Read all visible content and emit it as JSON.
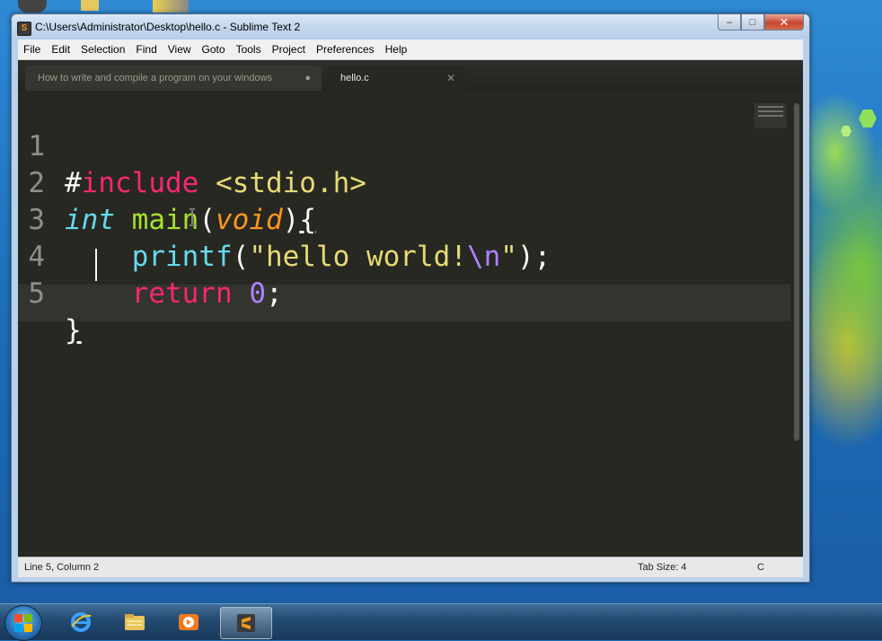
{
  "window": {
    "title": "C:\\Users\\Administrator\\Desktop\\hello.c - Sublime Text 2",
    "minimize": "–",
    "maximize": "□",
    "close": "✕"
  },
  "menu": [
    "File",
    "Edit",
    "Selection",
    "Find",
    "View",
    "Goto",
    "Tools",
    "Project",
    "Preferences",
    "Help"
  ],
  "tabs": [
    {
      "label": "How to write and compile a program on your windows",
      "marker": "●"
    },
    {
      "label": "hello.c",
      "marker": "✕"
    }
  ],
  "code": {
    "line_numbers": [
      "1",
      "2",
      "3",
      "4",
      "5"
    ],
    "line1": {
      "hash": "#",
      "include": "include",
      "header": " <stdio.h>"
    },
    "line2": {
      "int": "int",
      "main": " main",
      "paren_open": "(",
      "void": "void",
      "paren_close": ")",
      "brace": "{"
    },
    "line3": {
      "indent": "    ",
      "printf": "printf",
      "paren_open": "(",
      "string": "\"hello world!",
      "escape": "\\n",
      "quote": "\"",
      "end": ");"
    },
    "line4": {
      "indent": "    ",
      "return": "return",
      "space": " ",
      "zero": "0",
      "semi": ";"
    },
    "line5": {
      "brace": "}"
    }
  },
  "status": {
    "position": "Line 5, Column 2",
    "tab_size": "Tab Size: 4",
    "syntax": "C"
  },
  "colors": {
    "editor_bg": "#272822",
    "keyword": "#f92672",
    "type": "#66d9ef",
    "function": "#a6e22e",
    "string": "#e6db74",
    "number": "#ae81ff"
  },
  "taskbar": {
    "items": [
      "start-button",
      "internet-explorer-icon",
      "windows-explorer-icon",
      "media-player-icon",
      "sublime-text-icon"
    ]
  }
}
